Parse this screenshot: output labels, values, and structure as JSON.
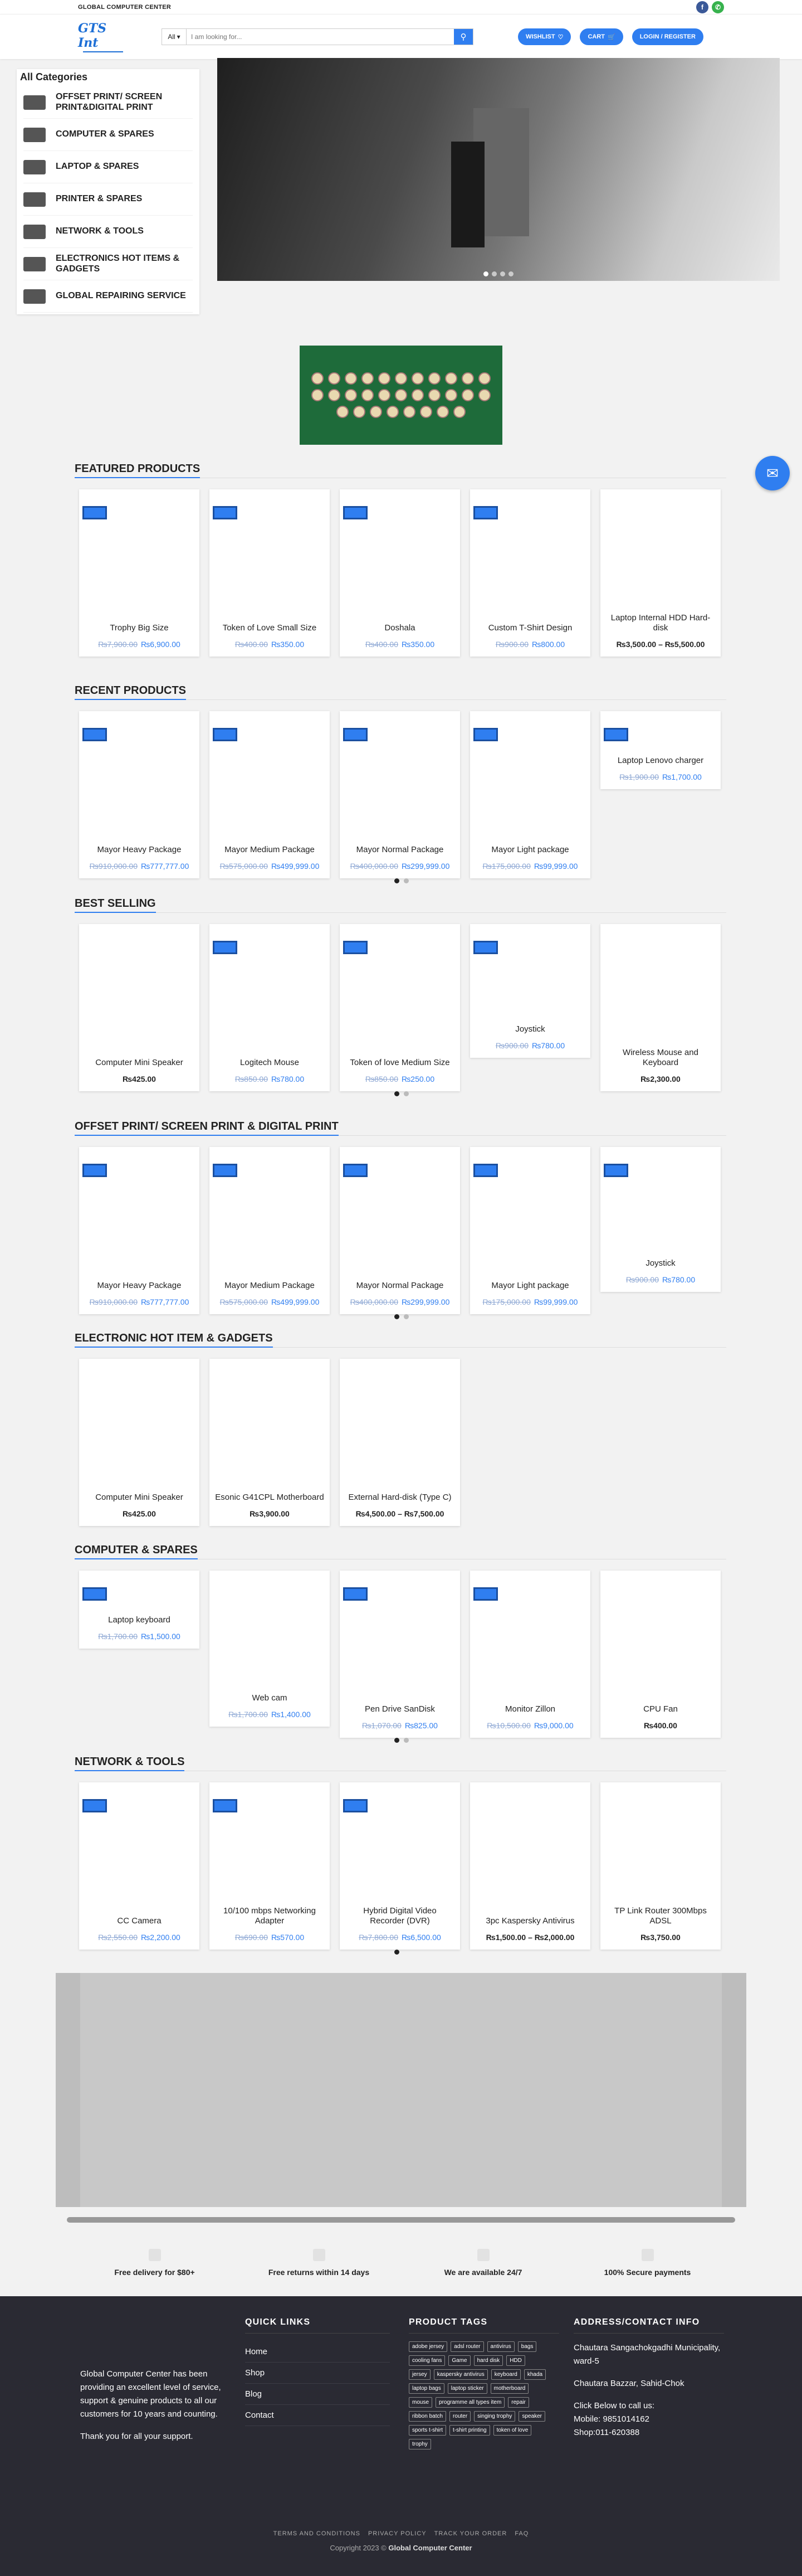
{
  "topbar": {
    "brand": "GLOBAL COMPUTER CENTER"
  },
  "header": {
    "logo_mark": "GTS Int",
    "search_category": "All",
    "search_placeholder": "I am looking for...",
    "wishlist": "Wishlist",
    "cart": "Cart",
    "login": "Login / Register"
  },
  "categories": {
    "title": "All Categories",
    "items": [
      "OFFSET PRINT/ SCREEN PRINT&DIGITAL PRINT",
      "COMPUTER & SPARES",
      "LAPTOP & SPARES",
      "PRINTER & SPARES",
      "NETWORK & TOOLS",
      "ELECTRONICS HOT ITEMS & GADGETS",
      "GLOBAL REPAIRING SERVICE"
    ]
  },
  "sections": [
    {
      "title": "FEATURED PRODUCTS",
      "products": [
        {
          "name": "Trophy Big Size",
          "old": "₨7,900.00",
          "new": "₨6,900.00",
          "sale": true
        },
        {
          "name": "Token of Love Small Size",
          "old": "₨400.00",
          "new": "₨350.00",
          "sale": true
        },
        {
          "name": "Doshala",
          "old": "₨400.00",
          "new": "₨350.00",
          "sale": true
        },
        {
          "name": "Custom T-Shirt Design",
          "old": "₨900.00",
          "new": "₨800.00",
          "sale": true
        },
        {
          "name": "Laptop Internal HDD Hard-disk",
          "plain": "₨3,500.00 – ₨5,500.00",
          "sale": false
        }
      ]
    },
    {
      "title": "RECENT PRODUCTS",
      "products": [
        {
          "name": "Mayor Heavy Package",
          "old": "₨910,000.00",
          "new": "₨777,777.00",
          "sale": true
        },
        {
          "name": "Mayor Medium Package",
          "old": "₨575,000.00",
          "new": "₨499,999.00",
          "sale": true
        },
        {
          "name": "Mayor Normal Package",
          "old": "₨400,000.00",
          "new": "₨299,999.00",
          "sale": true
        },
        {
          "name": "Mayor Light package",
          "old": "₨175,000.00",
          "new": "₨99,999.00",
          "sale": true
        },
        {
          "name": "Laptop Lenovo charger",
          "old": "₨1,900.00",
          "new": "₨1,700.00",
          "sale": true
        }
      ]
    },
    {
      "title": "BEST SELLING",
      "products": [
        {
          "name": "Computer Mini Speaker",
          "plain": "₨425.00",
          "sale": false
        },
        {
          "name": "Logitech Mouse",
          "old": "₨850.00",
          "new": "₨780.00",
          "sale": true
        },
        {
          "name": "Token of love Medium Size",
          "old": "₨850.00",
          "new": "₨250.00",
          "sale": true
        },
        {
          "name": "Joystick",
          "old": "₨900.00",
          "new": "₨780.00",
          "sale": true
        },
        {
          "name": "Wireless Mouse and Keyboard",
          "plain": "₨2,300.00",
          "sale": false
        }
      ]
    },
    {
      "title": "OFFSET PRINT/ SCREEN PRINT & DIGITAL PRINT",
      "products": [
        {
          "name": "Mayor Heavy Package",
          "old": "₨910,000.00",
          "new": "₨777,777.00",
          "sale": true
        },
        {
          "name": "Mayor Medium Package",
          "old": "₨575,000.00",
          "new": "₨499,999.00",
          "sale": true
        },
        {
          "name": "Mayor Normal Package",
          "old": "₨400,000.00",
          "new": "₨299,999.00",
          "sale": true
        },
        {
          "name": "Mayor Light package",
          "old": "₨175,000.00",
          "new": "₨99,999.00",
          "sale": true
        },
        {
          "name": "Joystick",
          "old": "₨900.00",
          "new": "₨780.00",
          "sale": true
        }
      ]
    },
    {
      "title": "ELECTRONIC HOT ITEM & GADGETS",
      "products": [
        {
          "name": "Computer Mini Speaker",
          "plain": "₨425.00",
          "sale": false
        },
        {
          "name": "Esonic G41CPL Motherboard",
          "plain": "₨3,900.00",
          "sale": false
        },
        {
          "name": "External Hard-disk (Type C)",
          "plain": "₨4,500.00 – ₨7,500.00",
          "sale": false
        }
      ]
    },
    {
      "title": "COMPUTER & SPARES",
      "products": [
        {
          "name": "Laptop keyboard",
          "old": "₨1,700.00",
          "new": "₨1,500.00",
          "sale": true
        },
        {
          "name": "Web cam",
          "old": "₨1,700.00",
          "new": "₨1,400.00",
          "sale": false
        },
        {
          "name": "Pen Drive SanDisk",
          "old": "₨1,070.00",
          "new": "₨825.00",
          "sale": true
        },
        {
          "name": "Monitor Zillon",
          "old": "₨10,500.00",
          "new": "₨9,000.00",
          "sale": true
        },
        {
          "name": "CPU Fan",
          "plain": "₨400.00",
          "sale": false
        }
      ]
    },
    {
      "title": "NETWORK & TOOLS",
      "products": [
        {
          "name": "CC Camera",
          "old": "₨2,550.00",
          "new": "₨2,200.00",
          "sale": true
        },
        {
          "name": "10/100 mbps Networking Adapter",
          "old": "₨690.00",
          "new": "₨570.00",
          "sale": true
        },
        {
          "name": "Hybrid Digital Video Recorder (DVR)",
          "old": "₨7,800.00",
          "new": "₨6,500.00",
          "sale": true
        },
        {
          "name": "3pc Kaspersky Antivirus",
          "plain": "₨1,500.00 – ₨2,000.00",
          "sale": false
        },
        {
          "name": "TP Link Router 300Mbps ADSL",
          "plain": "₨3,750.00",
          "sale": false
        }
      ]
    }
  ],
  "features": [
    "Free delivery for $80+",
    "Free returns within 14 days",
    "We are available 24/7",
    "100% Secure payments"
  ],
  "footer": {
    "about": [
      "Global Computer Center has been providing an excellent level of service, support & genuine products to all our customers for 10 years and counting.",
      "Thank you for all your support."
    ],
    "quick_links_title": "QUICK LINKS",
    "quick_links": [
      "Home",
      "Shop",
      "Blog",
      "Contact"
    ],
    "tags_title": "PRODUCT TAGS",
    "tags": [
      "adobe jersey",
      "adsl router",
      "antivirus",
      "bags",
      "cooling fans",
      "Game",
      "hard disk",
      "HDD",
      "jersey",
      "kaspersky antivirus",
      "keyboard",
      "khada",
      "laptop bags",
      "laptop sticker",
      "motherboard",
      "mouse",
      "programme all types item",
      "repair",
      "ribbon batch",
      "router",
      "singing trophy",
      "speaker",
      "sports t-shirt",
      "t-shirt printing",
      "token of love",
      "trophy"
    ],
    "address_title": "ADDRESS/CONTACT INFO",
    "address": [
      "Chautara Sangachokgadhi Municipality, ward-5",
      "Chautara Bazzar, Sahid-Chok",
      "Click Below to call us:",
      "Mobile: 9851014162",
      "Shop:011-620388"
    ],
    "bottom_links": [
      "TERMS AND CONDITIONS",
      "PRIVACY POLICY",
      "TRACK YOUR ORDER",
      "FAQ"
    ],
    "copyright": "Copyright 2023 ©",
    "copyright_brand": "Global Computer Center"
  },
  "colors": {
    "accent": "#2f7ef0",
    "footer_bg": "#2a2a33"
  }
}
